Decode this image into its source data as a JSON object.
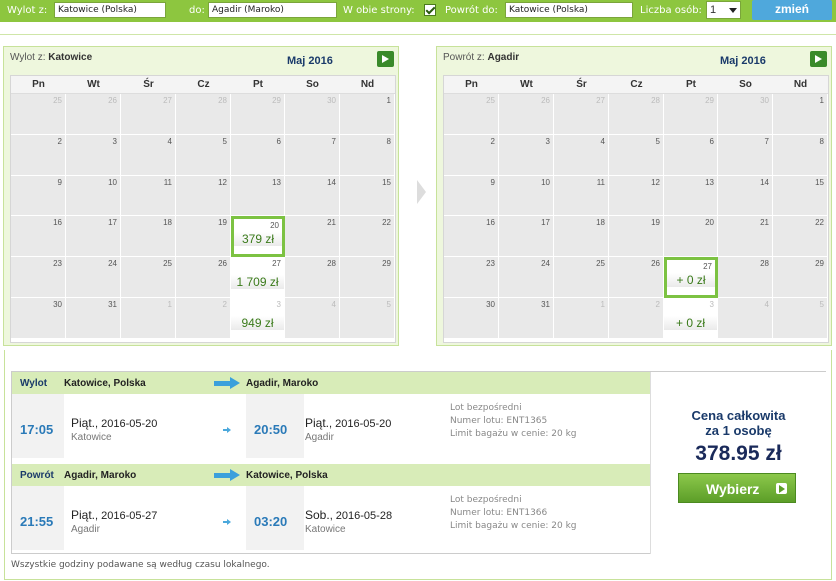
{
  "search": {
    "from_label": "Wylot z:",
    "from_value": "Katowice (Polska)",
    "to_label": "do:",
    "to_value": "Agadir (Maroko)",
    "roundtrip_label": "W obie strony:",
    "return_label": "Powrót do:",
    "return_value": "Katowice (Polska)",
    "persons_label": "Liczba osób:",
    "persons_value": "1",
    "submit_label": "zmień"
  },
  "weekdays": [
    "Pn",
    "Wt",
    "Śr",
    "Cz",
    "Pt",
    "So",
    "Nd"
  ],
  "outbound_calendar": {
    "title_prefix": "Wylot z:",
    "title_city": "Katowice",
    "month": "Maj 2016",
    "weeks": [
      [
        {
          "d": "25",
          "o": true
        },
        {
          "d": "26",
          "o": true
        },
        {
          "d": "27",
          "o": true
        },
        {
          "d": "28",
          "o": true
        },
        {
          "d": "29",
          "o": true
        },
        {
          "d": "30",
          "o": true
        },
        {
          "d": "1"
        }
      ],
      [
        {
          "d": "2"
        },
        {
          "d": "3"
        },
        {
          "d": "4"
        },
        {
          "d": "5"
        },
        {
          "d": "6"
        },
        {
          "d": "7"
        },
        {
          "d": "8"
        }
      ],
      [
        {
          "d": "9"
        },
        {
          "d": "10"
        },
        {
          "d": "11"
        },
        {
          "d": "12"
        },
        {
          "d": "13"
        },
        {
          "d": "14"
        },
        {
          "d": "15"
        }
      ],
      [
        {
          "d": "16"
        },
        {
          "d": "17"
        },
        {
          "d": "18"
        },
        {
          "d": "19"
        },
        {
          "d": "20",
          "p": "379 zł",
          "s": true
        },
        {
          "d": "21"
        },
        {
          "d": "22"
        }
      ],
      [
        {
          "d": "23"
        },
        {
          "d": "24"
        },
        {
          "d": "25"
        },
        {
          "d": "26"
        },
        {
          "d": "27",
          "p": "1 709 zł"
        },
        {
          "d": "28"
        },
        {
          "d": "29"
        }
      ],
      [
        {
          "d": "30"
        },
        {
          "d": "31"
        },
        {
          "d": "1",
          "o": true
        },
        {
          "d": "2",
          "o": true
        },
        {
          "d": "3",
          "o": true,
          "p": "949 zł"
        },
        {
          "d": "4",
          "o": true
        },
        {
          "d": "5",
          "o": true
        }
      ]
    ]
  },
  "return_calendar": {
    "title_prefix": "Powrót z:",
    "title_city": "Agadir",
    "month": "Maj 2016",
    "weeks": [
      [
        {
          "d": "25",
          "o": true
        },
        {
          "d": "26",
          "o": true
        },
        {
          "d": "27",
          "o": true
        },
        {
          "d": "28",
          "o": true
        },
        {
          "d": "29",
          "o": true
        },
        {
          "d": "30",
          "o": true
        },
        {
          "d": "1"
        }
      ],
      [
        {
          "d": "2"
        },
        {
          "d": "3"
        },
        {
          "d": "4"
        },
        {
          "d": "5"
        },
        {
          "d": "6"
        },
        {
          "d": "7"
        },
        {
          "d": "8"
        }
      ],
      [
        {
          "d": "9"
        },
        {
          "d": "10"
        },
        {
          "d": "11"
        },
        {
          "d": "12"
        },
        {
          "d": "13"
        },
        {
          "d": "14"
        },
        {
          "d": "15"
        }
      ],
      [
        {
          "d": "16"
        },
        {
          "d": "17"
        },
        {
          "d": "18"
        },
        {
          "d": "19"
        },
        {
          "d": "20"
        },
        {
          "d": "21"
        },
        {
          "d": "22"
        }
      ],
      [
        {
          "d": "23"
        },
        {
          "d": "24"
        },
        {
          "d": "25"
        },
        {
          "d": "26"
        },
        {
          "d": "27",
          "p": "+ 0 zł",
          "s": true
        },
        {
          "d": "28"
        },
        {
          "d": "29"
        }
      ],
      [
        {
          "d": "30"
        },
        {
          "d": "31"
        },
        {
          "d": "1",
          "o": true
        },
        {
          "d": "2",
          "o": true
        },
        {
          "d": "3",
          "o": true,
          "p": "+ 0 zł"
        },
        {
          "d": "4",
          "o": true
        },
        {
          "d": "5",
          "o": true
        }
      ]
    ]
  },
  "outbound": {
    "label": "Wylot",
    "from": "Katowice, Polska",
    "to": "Agadir, Maroko",
    "dep_time": "17:05",
    "dep_day": "Piąt.",
    "dep_date": ", 2016-05-20",
    "dep_city": "Katowice",
    "arr_time": "20:50",
    "arr_day": "Piąt.",
    "arr_date": ", 2016-05-20",
    "arr_city": "Agadir",
    "info1": "Lot bezpośredni",
    "info2": "Numer lotu: ENT1365",
    "info3": "Limit bagażu w cenie: 20 kg"
  },
  "inbound": {
    "label": "Powrót",
    "from": "Agadir, Maroko",
    "to": "Katowice, Polska",
    "dep_time": "21:55",
    "dep_day": "Piąt.",
    "dep_date": ", 2016-05-27",
    "dep_city": "Agadir",
    "arr_time": "03:20",
    "arr_day": "Sob.",
    "arr_date": ", 2016-05-28",
    "arr_city": "Katowice",
    "info1": "Lot bezpośredni",
    "info2": "Numer lotu: ENT1366",
    "info3": "Limit bagażu w cenie: 20 kg"
  },
  "price": {
    "line1": "Cena całkowita",
    "line2": "za 1 osobę",
    "amount": "378.95 zł",
    "button": "Wybierz"
  },
  "note": "Wszystkie godziny podawane są według czasu lokalnego."
}
